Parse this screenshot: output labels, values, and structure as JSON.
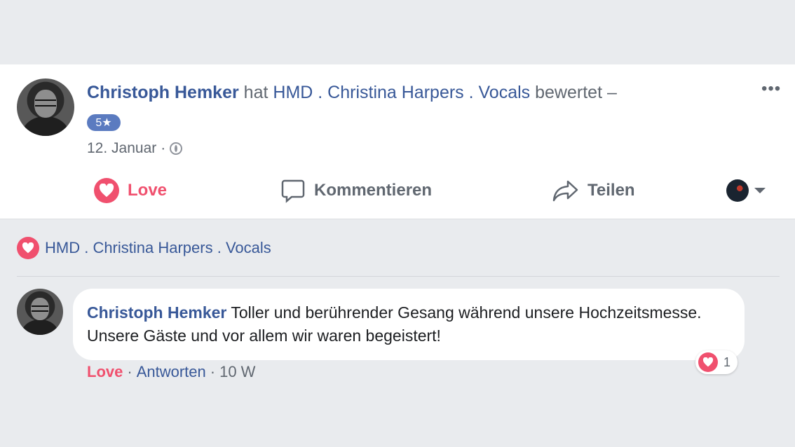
{
  "post": {
    "author": "Christoph Hemker",
    "verb": "hat",
    "page_name": "HMD . Christina Harpers . Vocals",
    "action_text": "bewertet –",
    "rating": "5★",
    "date": "12. Januar",
    "separator": "·",
    "more_label": "•••"
  },
  "actions": {
    "love_label": "Love",
    "comment_label": "Kommentieren",
    "share_label": "Teilen"
  },
  "reactions": {
    "page_name": "HMD . Christina Harpers . Vocals"
  },
  "comment": {
    "author": "Christoph Hemker",
    "text": "Toller und berührender Gesang während unsere Hochzeitsmesse. Unsere Gäste und vor allem wir waren begeistert!",
    "reaction_count": "1",
    "love_label": "Love",
    "reply_label": "Antworten",
    "sep1": "·",
    "sep2": "·",
    "time": "10 W"
  },
  "colors": {
    "link": "#385898",
    "love": "#f0506e",
    "badge": "#5b7bc0",
    "muted": "#606770",
    "background": "#e9ebee"
  },
  "icons": [
    "heart-icon",
    "comment-icon",
    "share-icon",
    "globe-icon",
    "more-icon",
    "caret-down-icon"
  ]
}
